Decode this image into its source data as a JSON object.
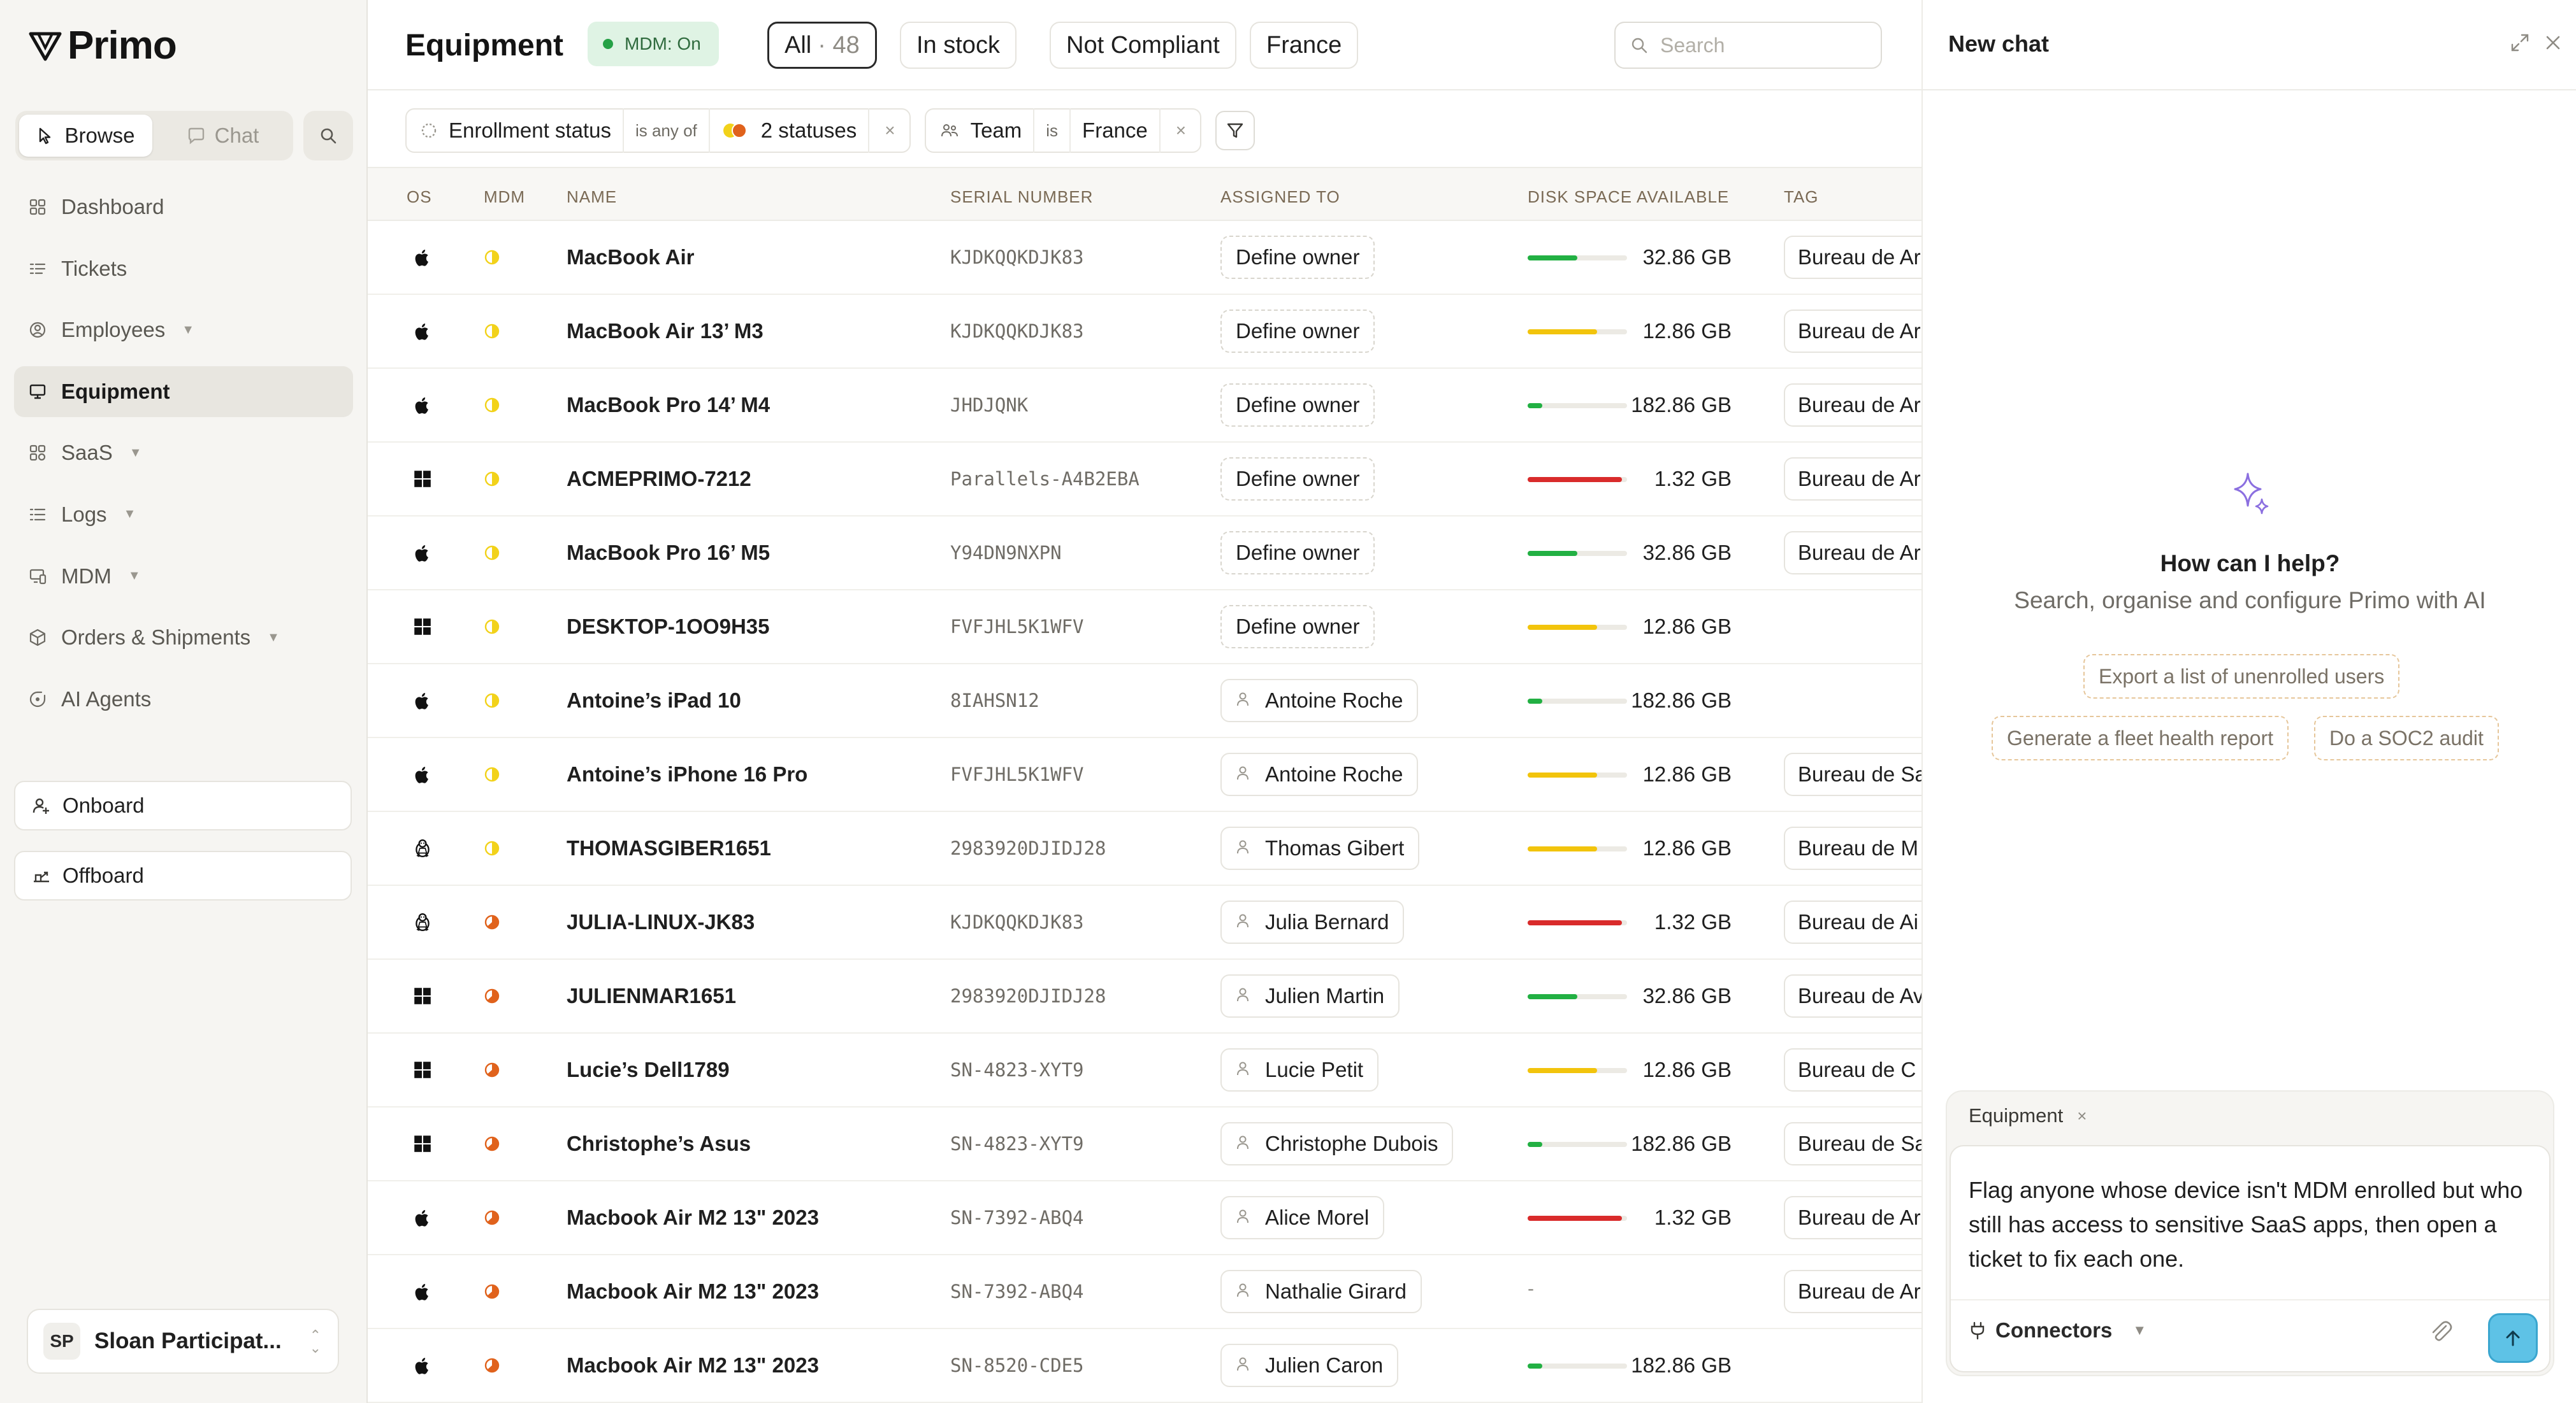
{
  "app": {
    "name": "Primo"
  },
  "sidebar": {
    "segment": {
      "browse": "Browse",
      "chat": "Chat"
    },
    "items": [
      {
        "label": "Dashboard",
        "icon": "dashboard-icon",
        "caret": false
      },
      {
        "label": "Tickets",
        "icon": "tickets-icon",
        "caret": false
      },
      {
        "label": "Employees",
        "icon": "employees-icon",
        "caret": true
      },
      {
        "label": "Equipment",
        "icon": "equipment-icon",
        "caret": false,
        "active": true
      },
      {
        "label": "SaaS",
        "icon": "saas-icon",
        "caret": true
      },
      {
        "label": "Logs",
        "icon": "logs-icon",
        "caret": true
      },
      {
        "label": "MDM",
        "icon": "mdm-icon",
        "caret": true
      },
      {
        "label": "Orders & Shipments",
        "icon": "orders-icon",
        "caret": true
      },
      {
        "label": "AI Agents",
        "icon": "ai-agents-icon",
        "caret": false
      }
    ],
    "onboard": "Onboard",
    "offboard": "Offboard",
    "user": {
      "initials": "SP",
      "name": "Sloan Participat..."
    }
  },
  "header": {
    "title": "Equipment",
    "mdm_badge": "MDM: On",
    "tabs": [
      {
        "label": "All",
        "count": "· 48",
        "active": true
      },
      {
        "label": "In stock"
      },
      {
        "label": "Not Compliant"
      },
      {
        "label": "France"
      }
    ],
    "search_placeholder": "Search"
  },
  "filters": {
    "enrollment": {
      "field": "Enrollment status",
      "op": "is any of",
      "value": "2 statuses"
    },
    "team": {
      "field": "Team",
      "op": "is",
      "value": "France"
    }
  },
  "table": {
    "columns": {
      "os": "OS",
      "mdm": "MDM",
      "name": "NAME",
      "serial": "SERIAL NUMBER",
      "assigned": "ASSIGNED TO",
      "disk": "DISK SPACE AVAILABLE",
      "tag": "TAG"
    },
    "rows": [
      {
        "os": "apple",
        "mdm": "pending",
        "name": "MacBook Air",
        "serial": "KJDKQQKDJK83",
        "owner": "Define owner",
        "owner_defined": false,
        "disk": "32.86 GB",
        "disk_level": 0.5,
        "disk_status": "good",
        "tag": "Bureau de Ar"
      },
      {
        "os": "apple",
        "mdm": "pending",
        "name": "MacBook Air 13’ M3",
        "serial": "KJDKQQKDJK83",
        "owner": "Define owner",
        "owner_defined": false,
        "disk": "12.86 GB",
        "disk_level": 0.7,
        "disk_status": "warning",
        "tag": "Bureau de Ar"
      },
      {
        "os": "apple",
        "mdm": "pending",
        "name": "MacBook Pro 14’ M4",
        "serial": "JHDJQNK",
        "owner": "Define owner",
        "owner_defined": false,
        "disk": "182.86 GB",
        "disk_level": 0.15,
        "disk_status": "good",
        "tag": "Bureau de Ar"
      },
      {
        "os": "windows",
        "mdm": "pending",
        "name": "ACMEPRIMO-7212",
        "serial": "Parallels-A4B2EBA",
        "owner": "Define owner",
        "owner_defined": false,
        "disk": "1.32 GB",
        "disk_level": 0.95,
        "disk_status": "critical",
        "tag": "Bureau de Ar"
      },
      {
        "os": "apple",
        "mdm": "pending",
        "name": "MacBook Pro 16’ M5",
        "serial": "Y94DN9NXPN",
        "owner": "Define owner",
        "owner_defined": false,
        "disk": "32.86 GB",
        "disk_level": 0.5,
        "disk_status": "good",
        "tag": "Bureau de Ar"
      },
      {
        "os": "windows",
        "mdm": "pending",
        "name": "DESKTOP-1OO9H35",
        "serial": "FVFJHL5K1WFV",
        "owner": "Define owner",
        "owner_defined": false,
        "disk": "12.86 GB",
        "disk_level": 0.7,
        "disk_status": "warning",
        "tag": ""
      },
      {
        "os": "apple",
        "mdm": "pending",
        "name": "Antoine’s iPad 10",
        "serial": "8IAHSN12",
        "owner": "Antoine Roche",
        "owner_defined": true,
        "disk": "182.86 GB",
        "disk_level": 0.15,
        "disk_status": "good",
        "tag": ""
      },
      {
        "os": "apple",
        "mdm": "pending",
        "name": "Antoine’s iPhone 16 Pro",
        "serial": "FVFJHL5K1WFV",
        "owner": "Antoine Roche",
        "owner_defined": true,
        "disk": "12.86 GB",
        "disk_level": 0.7,
        "disk_status": "warning",
        "tag": "Bureau de Sa"
      },
      {
        "os": "linux",
        "mdm": "pending",
        "name": "THOMASGIBER1651",
        "serial": "2983920DJIDJ28",
        "owner": "Thomas Gibert",
        "owner_defined": true,
        "disk": "12.86 GB",
        "disk_level": 0.7,
        "disk_status": "warning",
        "tag": "Bureau de M"
      },
      {
        "os": "linux",
        "mdm": "partial",
        "name": "JULIA-LINUX-JK83",
        "serial": "KJDKQQKDJK83",
        "owner": "Julia Bernard",
        "owner_defined": true,
        "disk": "1.32 GB",
        "disk_level": 0.95,
        "disk_status": "critical",
        "tag": "Bureau de Ai"
      },
      {
        "os": "windows",
        "mdm": "partial",
        "name": "JULIENMAR1651",
        "serial": "2983920DJIDJ28",
        "owner": "Julien Martin",
        "owner_defined": true,
        "disk": "32.86 GB",
        "disk_level": 0.5,
        "disk_status": "good",
        "tag": "Bureau de Av"
      },
      {
        "os": "windows",
        "mdm": "partial",
        "name": "Lucie’s Dell1789",
        "serial": "SN-4823-XYT9",
        "owner": "Lucie Petit",
        "owner_defined": true,
        "disk": "12.86 GB",
        "disk_level": 0.7,
        "disk_status": "warning",
        "tag": "Bureau de C"
      },
      {
        "os": "windows",
        "mdm": "partial",
        "name": "Christophe’s Asus",
        "serial": "SN-4823-XYT9",
        "owner": "Christophe Dubois",
        "owner_defined": true,
        "disk": "182.86 GB",
        "disk_level": 0.15,
        "disk_status": "good",
        "tag": "Bureau de Sa"
      },
      {
        "os": "apple",
        "mdm": "partial",
        "name": "Macbook Air M2 13\" 2023",
        "serial": "SN-7392-ABQ4",
        "owner": "Alice Morel",
        "owner_defined": true,
        "disk": "1.32 GB",
        "disk_level": 0.95,
        "disk_status": "critical",
        "tag": "Bureau de Ar"
      },
      {
        "os": "apple",
        "mdm": "partial",
        "name": "Macbook Air M2 13\" 2023",
        "serial": "SN-7392-ABQ4",
        "owner": "Nathalie Girard",
        "owner_defined": true,
        "disk": "-",
        "disk_level": null,
        "disk_status": "none",
        "tag": "Bureau de Ar"
      },
      {
        "os": "apple",
        "mdm": "partial",
        "name": "Macbook Air M2 13\" 2023",
        "serial": "SN-8520-CDE5",
        "owner": "Julien Caron",
        "owner_defined": true,
        "disk": "182.86 GB",
        "disk_level": 0.15,
        "disk_status": "good",
        "tag": ""
      }
    ]
  },
  "colors": {
    "good": "#22b043",
    "warning": "#f2c40c",
    "critical": "#d92b2b",
    "mdm_pending": "#f2d21a",
    "mdm_partial": "#e0621c"
  },
  "chat": {
    "title": "New chat",
    "help_title": "How can I help?",
    "help_sub": "Search, organise and configure Primo with AI",
    "suggestions": [
      "Export a list of unenrolled users",
      "Generate a fleet health report",
      "Do a SOC2 audit"
    ],
    "context_chip": "Equipment",
    "prompt": "Flag anyone whose device isn't MDM enrolled but who still has access to sensitive SaaS apps, then open a ticket to fix each one.",
    "connectors": "Connectors"
  }
}
